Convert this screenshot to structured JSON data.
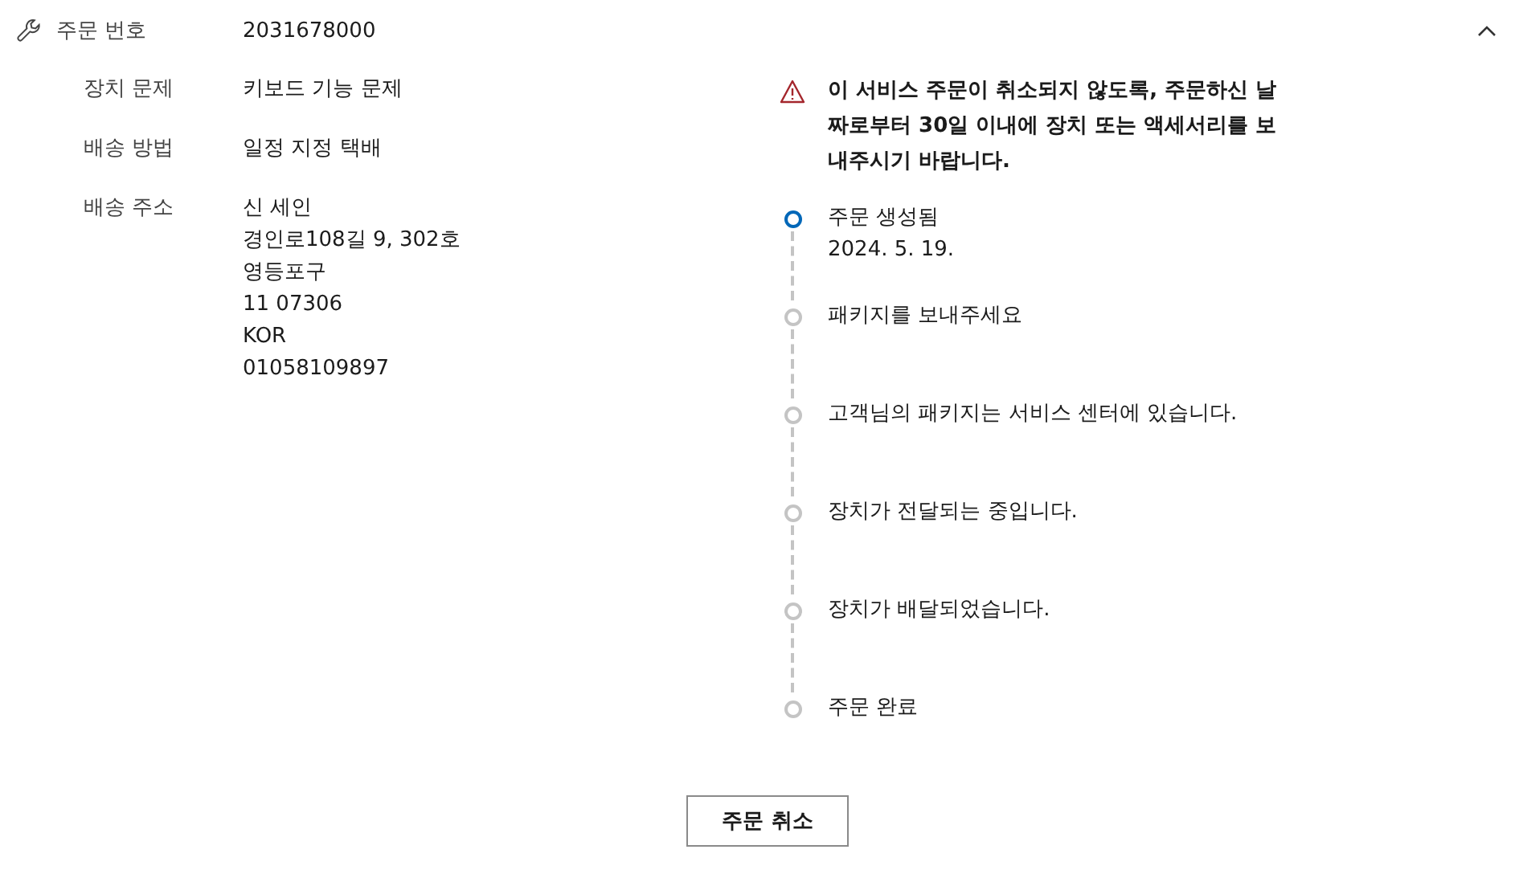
{
  "header": {
    "label": "주문 번호",
    "value": "2031678000",
    "expanded": true
  },
  "details": [
    {
      "label": "장치 문제",
      "lines": [
        "키보드 기능 문제"
      ]
    },
    {
      "label": "배송 방법",
      "lines": [
        "일정 지정 택배"
      ]
    },
    {
      "label": "배송 주소",
      "lines": [
        "신 세인",
        "경인로108길 9, 302호",
        "영등포구",
        "11 07306",
        "KOR",
        "01058109897"
      ]
    }
  ],
  "warning": "이 서비스 주문이 취소되지 않도록, 주문하신 날짜로부터 30일 이내에 장치 또는 액세서리를 보내주시기 바랍니다.",
  "timeline": [
    {
      "title": "주문 생성됨",
      "date": "2024. 5. 19.",
      "current": true
    },
    {
      "title": "패키지를 보내주세요",
      "current": false
    },
    {
      "title": "고객님의 패키지는 서비스 센터에 있습니다.",
      "current": false
    },
    {
      "title": "장치가 전달되는 중입니다.",
      "current": false
    },
    {
      "title": "장치가 배달되었습니다.",
      "current": false
    },
    {
      "title": "주문 완료",
      "current": false
    }
  ],
  "cancel_button": "주문 취소"
}
